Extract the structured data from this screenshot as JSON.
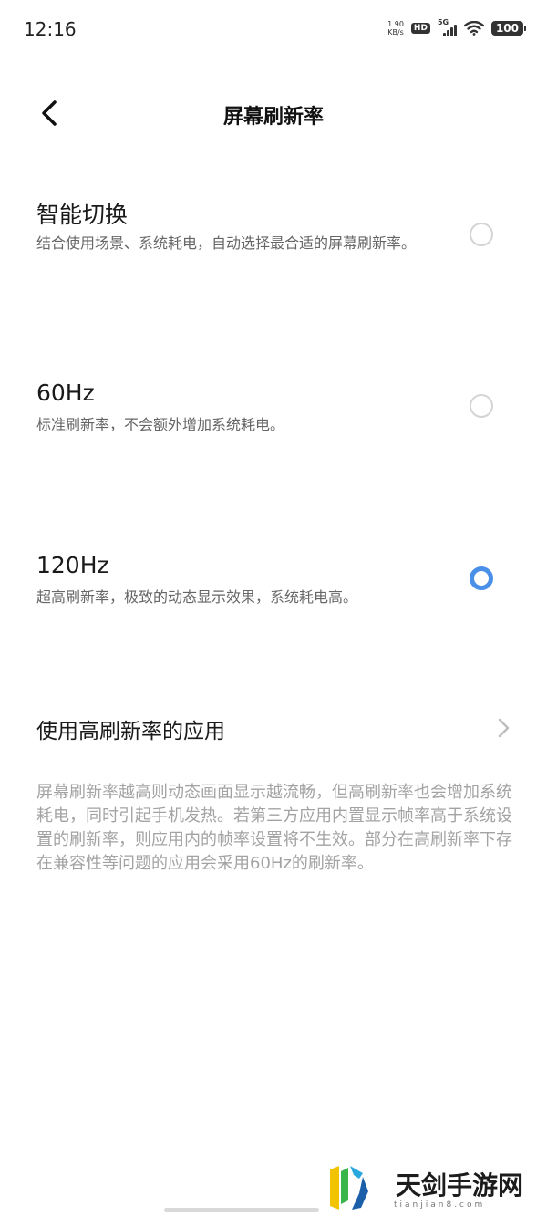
{
  "status_bar": {
    "time": "12:16",
    "net_speed_value": "1.90",
    "net_speed_unit": "KB/s",
    "hd_label": "HD",
    "network_label": "5G",
    "battery": "100"
  },
  "header": {
    "title": "屏幕刷新率",
    "back_icon": "chevron-left-icon"
  },
  "options": [
    {
      "title": "智能切换",
      "desc": "结合使用场景、系统耗电，自动选择最合适的屏幕刷新率。",
      "selected": false
    },
    {
      "title": "60Hz",
      "desc": "标准刷新率，不会额外增加系统耗电。",
      "selected": false
    },
    {
      "title": "120Hz",
      "desc": "超高刷新率，极致的动态显示效果，系统耗电高。",
      "selected": true
    }
  ],
  "apps_row": {
    "title": "使用高刷新率的应用",
    "icon": "chevron-right-icon"
  },
  "note": "屏幕刷新率越高则动态画面显示越流畅，但高刷新率也会增加系统耗电，同时引起手机发热。若第三方应用内置显示帧率高于系统设置的刷新率，则应用内的帧率设置将不生效。部分在高刷新率下存在兼容性等问题的应用会采用60Hz的刷新率。",
  "watermark": {
    "text": "天剑手游网",
    "url": "tianjian8.com"
  },
  "colors": {
    "accent": "#4a90e8",
    "radio_off": "#d4d4d4",
    "desc": "#666666",
    "note": "#a3a3a3"
  }
}
